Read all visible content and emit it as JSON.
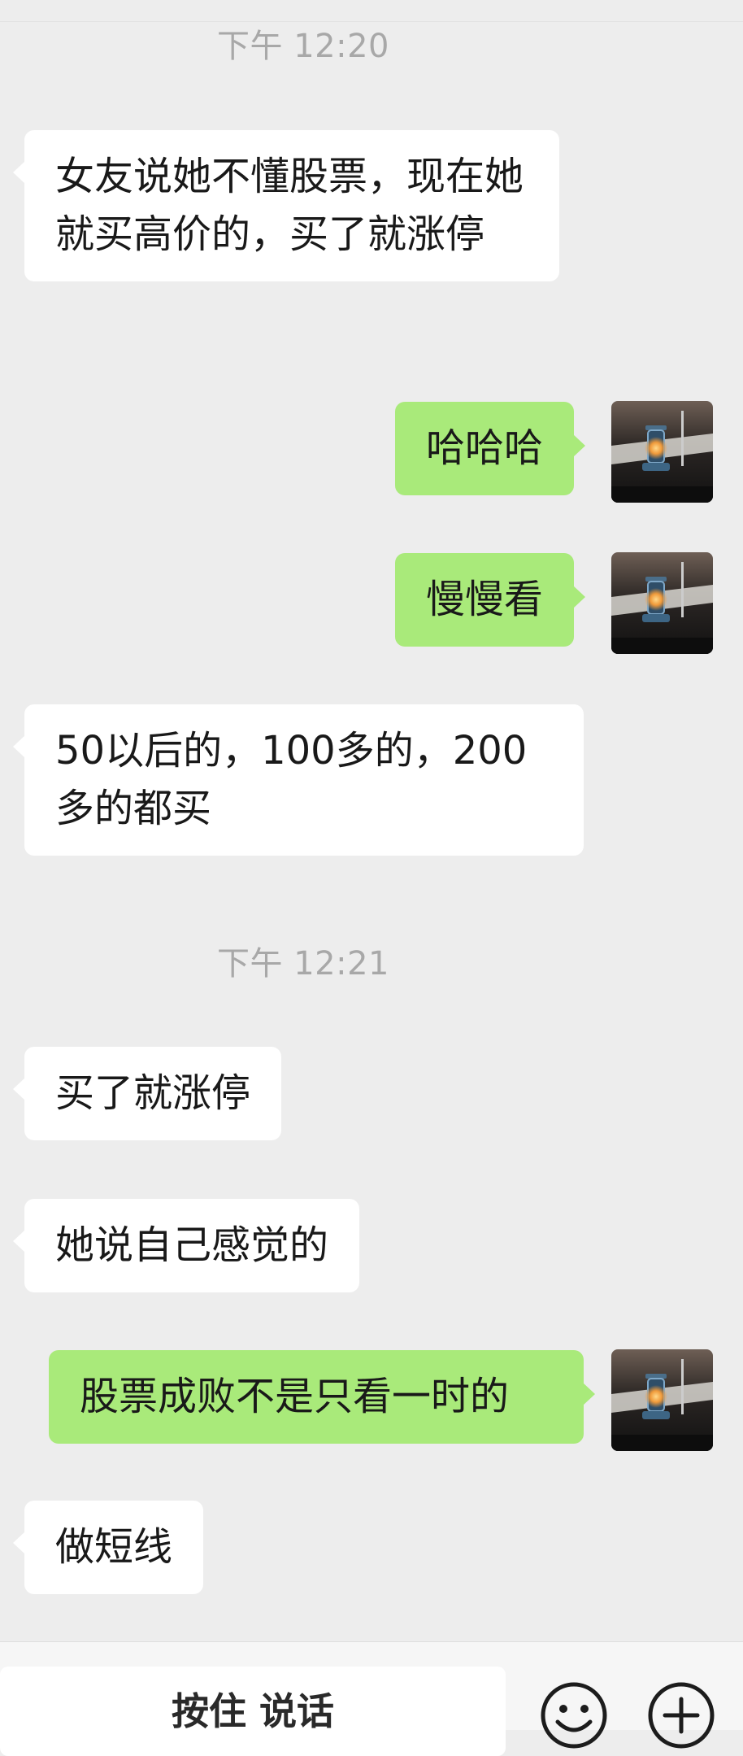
{
  "chat": {
    "timestamps": [
      "下午 12:20",
      "下午 12:21"
    ],
    "messages": [
      {
        "side": "in",
        "text": "女友说她不懂股票，现在她就买高价的，买了就涨停"
      },
      {
        "side": "out",
        "text": "哈哈哈"
      },
      {
        "side": "out",
        "text": "慢慢看"
      },
      {
        "side": "in",
        "text": "50以后的，100多的，200多的都买"
      },
      {
        "side": "in",
        "text": "买了就涨停"
      },
      {
        "side": "in",
        "text": "她说自己感觉的"
      },
      {
        "side": "out",
        "text": "股票成败不是只看一时的"
      },
      {
        "side": "in",
        "text": "做短线"
      }
    ]
  },
  "input_bar": {
    "talk_label": "按住 说话",
    "icons": [
      "emoji-icon",
      "plus-icon"
    ]
  },
  "colors": {
    "background": "#ededed",
    "incoming_bubble": "#ffffff",
    "outgoing_bubble": "#a9ea7a",
    "timestamp_text": "#a8a8a8"
  }
}
